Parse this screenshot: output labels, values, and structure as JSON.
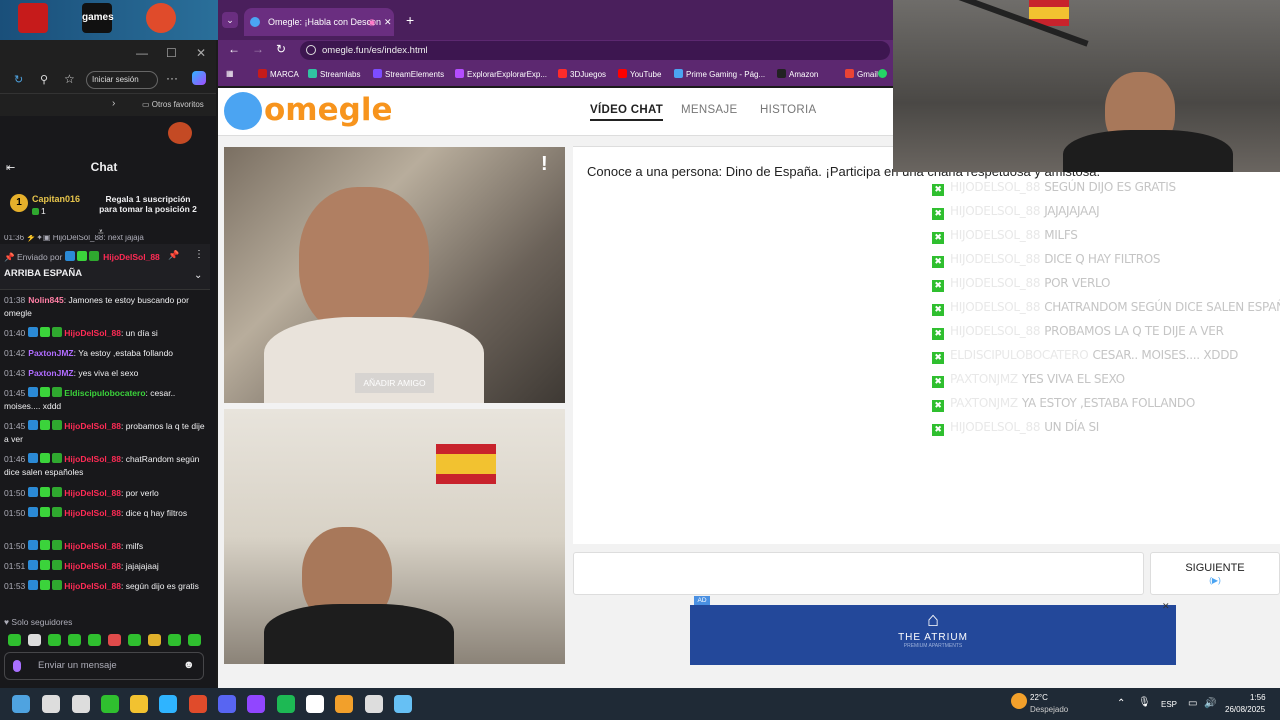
{
  "desktop": {
    "icon_label": "games"
  },
  "chat": {
    "title": "Chat",
    "signin_label": "Iniciar sesión",
    "favorites_label": "Otros favoritos",
    "top_user": "Capitan016",
    "top_rank": "1",
    "top_count": "1",
    "gift_text_1": "Regala 1 suscripción",
    "gift_text_2": "para tomar la posición 2",
    "partial_line": "01:36 ⚡✦▣ HijoDelSol_88: next jajaja",
    "pinned_by_label": "Enviado por",
    "pinned_user": "HijoDelSol_88",
    "pinned_message": "ARRIBA ESPAÑA",
    "messages": [
      {
        "time": "01:38",
        "user": "Nolin845",
        "color": "#ff7fa5",
        "text": ": Jamones te estoy buscando por omegle",
        "badges": false
      },
      {
        "time": "01:40",
        "user": "HijoDelSol_88",
        "color": "#ff2b55",
        "text": ": un día si",
        "badges": true
      },
      {
        "time": "01:42",
        "user": "PaxtonJMZ",
        "color": "#b06cff",
        "text": ": Ya estoy ,estaba follando",
        "badges": false
      },
      {
        "time": "01:43",
        "user": "PaxtonJMZ",
        "color": "#b06cff",
        "text": ": yes viva el sexo",
        "badges": false
      },
      {
        "time": "01:45",
        "user": "Eldiscipulobocatero",
        "color": "#3bd33b",
        "text": ": cesar.. moises.... xddd",
        "badges": true
      },
      {
        "time": "01:45",
        "user": "HijoDelSol_88",
        "color": "#ff2b55",
        "text": ": probamos la q te dije a ver",
        "badges": true
      },
      {
        "time": "01:46",
        "user": "HijoDelSol_88",
        "color": "#ff2b55",
        "text": ": chatRandom según dice salen españoles",
        "badges": true
      },
      {
        "time": "01:50",
        "user": "HijoDelSol_88",
        "color": "#ff2b55",
        "text": ": por verlo",
        "badges": true
      },
      {
        "time": "01:50",
        "user": "HijoDelSol_88",
        "color": "#ff2b55",
        "text": ": dice q hay filtros",
        "badges": true
      },
      {
        "time": "01:50",
        "user": "HijoDelSol_88",
        "color": "#ff2b55",
        "text": ": milfs",
        "badges": true
      },
      {
        "time": "01:51",
        "user": "HijoDelSol_88",
        "color": "#ff2b55",
        "text": ": jajajajaaj",
        "badges": true
      },
      {
        "time": "01:53",
        "user": "HijoDelSol_88",
        "color": "#ff2b55",
        "text": ": según dijo es gratis",
        "badges": true
      }
    ],
    "followers_only": "Solo seguidores",
    "input_placeholder": "Enviar un mensaje"
  },
  "browser": {
    "tab_title": "Omegle: ¡Habla con Descon",
    "url": "omegle.fun/es/index.html",
    "bookmarks": [
      "MARCA",
      "Streamlabs",
      "StreamElements",
      "ExplorarExplorarExp...",
      "3DJuegos",
      "YouTube",
      "Prime Gaming - Pág...",
      "Amazon",
      "Gmail"
    ]
  },
  "omegle": {
    "logo": "omegle",
    "nav": [
      "VÍDEO CHAT",
      "MENSAJE",
      "HISTORIA"
    ],
    "add_friend": "AÑADIR AMIGO",
    "intro_text": "Conoce a una persona: Dino de España. ¡Participa en una charla respetuosa y amistosa.",
    "next_label": "SIGUIENTE",
    "next_hint": "(▶)",
    "ad_badge": "AD",
    "ad_text": "THE ATRIUM",
    "ad_subtext": "PREMIUM APARTMENTS"
  },
  "overlay": {
    "messages": [
      {
        "user": "HIJODELSOL_88",
        "text": "SEGÚN DIJO ES GRATIS"
      },
      {
        "user": "HIJODELSOL_88",
        "text": "JAJAJAJAAJ"
      },
      {
        "user": "HIJODELSOL_88",
        "text": "MILFS"
      },
      {
        "user": "HIJODELSOL_88",
        "text": "DICE Q HAY FILTROS"
      },
      {
        "user": "HIJODELSOL_88",
        "text": "POR VERLO"
      },
      {
        "user": "HIJODELSOL_88",
        "text": "CHATRANDOM SEGÚN DICE SALEN ESPAÑOLES"
      },
      {
        "user": "HIJODELSOL_88",
        "text": "PROBAMOS LA Q TE DIJE A VER"
      },
      {
        "user": "ELDISCIPULOBOCATERO",
        "text": "CESAR.. MOISES.... XDDD"
      },
      {
        "user": "PAXTONJMZ",
        "text": "YES VIVA EL SEXO"
      },
      {
        "user": "PAXTONJMZ",
        "text": "YA ESTOY ,ESTABA FOLLANDO"
      },
      {
        "user": "HIJODELSOL_88",
        "text": "UN DÍA SI"
      }
    ]
  },
  "taskbar": {
    "weather_temp": "22°C",
    "weather_text": "Despejado",
    "language": "ESP",
    "time": "1:56",
    "date": "26/08/2025"
  }
}
